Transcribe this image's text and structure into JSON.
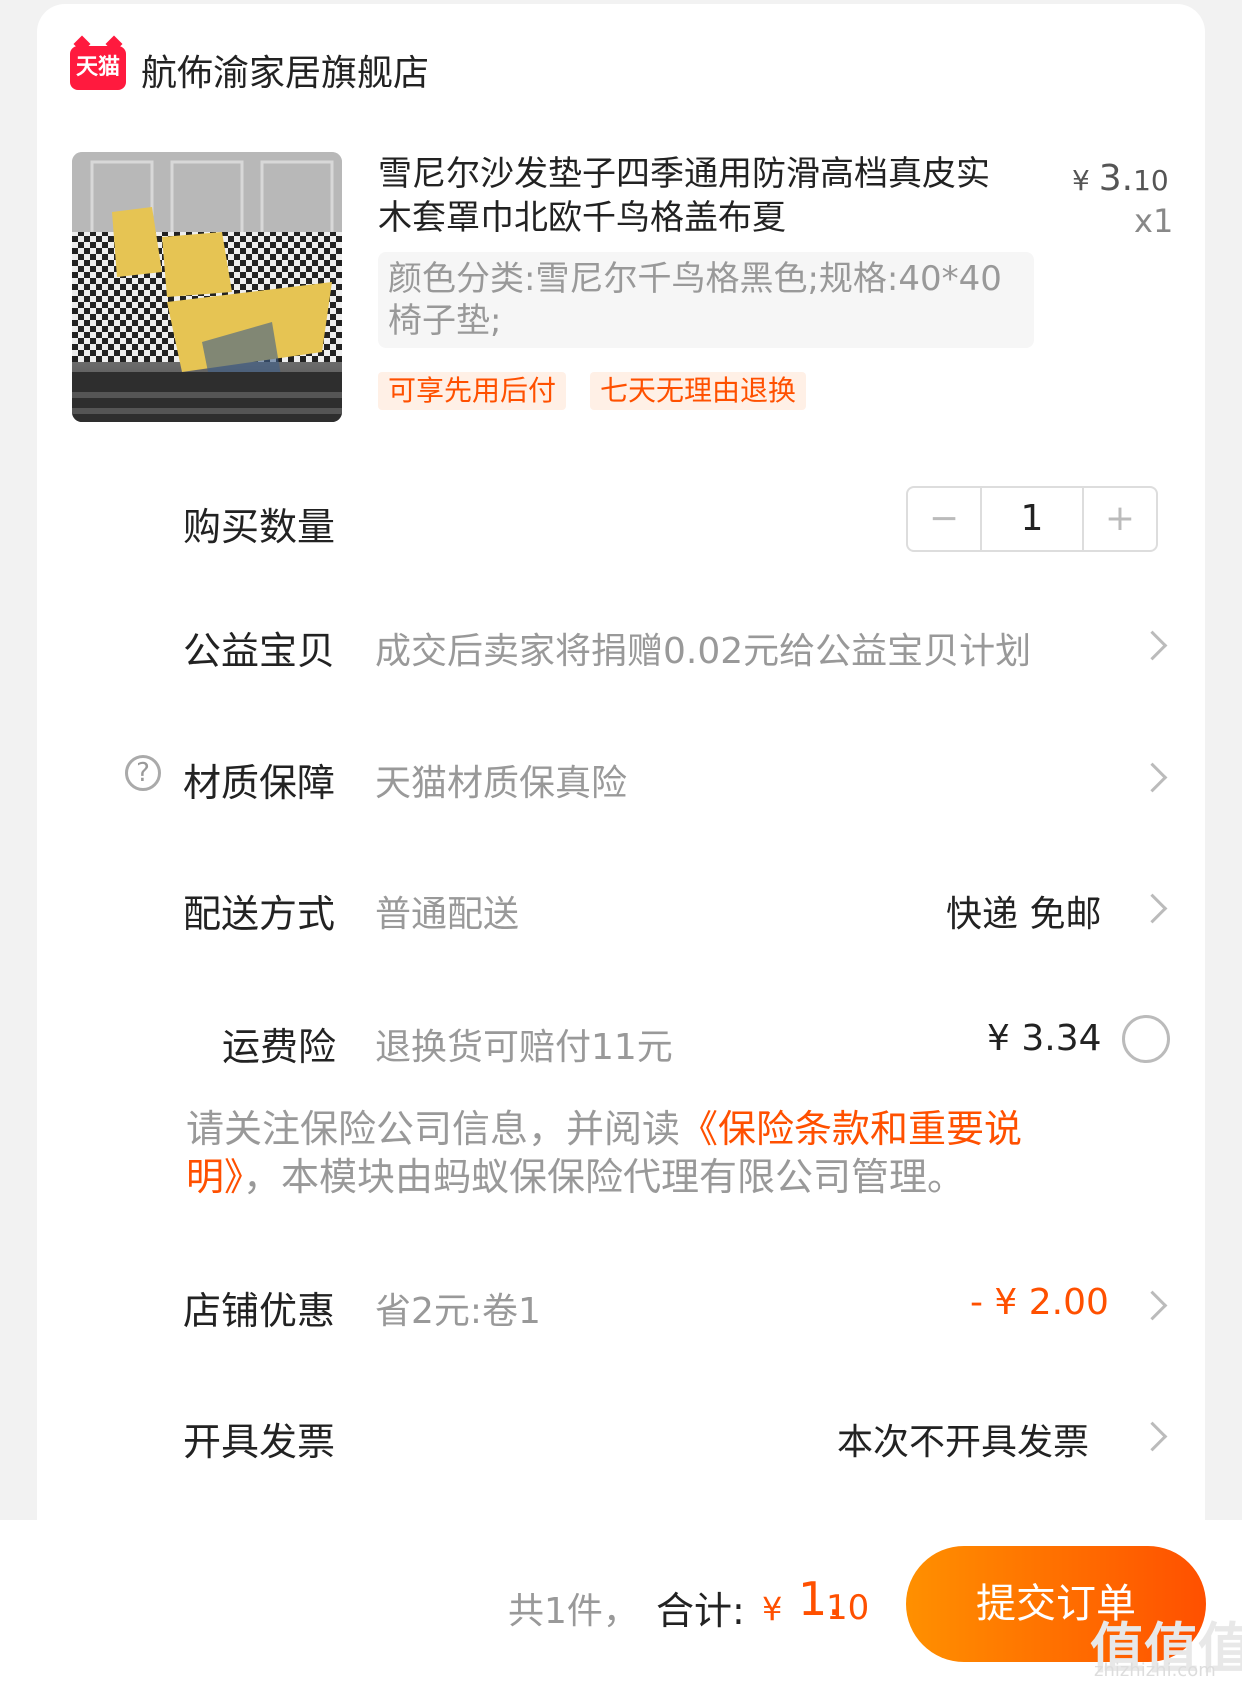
{
  "shop": {
    "logo_text": "天猫",
    "name": "航佈渝家居旗舰店"
  },
  "product": {
    "title": "雪尼尔沙发垫子四季通用防滑高档真皮实木套罩巾北欧千鸟格盖布夏",
    "price_symbol": "¥",
    "price_int": "3.",
    "price_dec": "10",
    "quantity_text": "x1",
    "sku": "颜色分类:雪尼尔千鸟格黑色;规格:40*40 椅子垫;",
    "tags": [
      "可享先用后付",
      "七天无理由退换"
    ]
  },
  "rows": {
    "quantity": {
      "label": "购买数量",
      "minus": "−",
      "value": "1",
      "plus": "+"
    },
    "charity": {
      "label": "公益宝贝",
      "value": "成交后卖家将捐赠0.02元给公益宝贝计划"
    },
    "material": {
      "label": "材质保障",
      "help": "?",
      "value": "天猫材质保真险"
    },
    "delivery": {
      "label": "配送方式",
      "value": "普通配送",
      "right": "快递 免邮"
    },
    "freight_insurance": {
      "label": "运费险",
      "value": "退换货可赔付11元",
      "right": "¥ 3.34"
    },
    "notice": {
      "before": "请关注保险公司信息，并阅读",
      "link": "《保险条款和重要说明》",
      "after": "，本模块由蚂蚁保保险代理有限公司管理。"
    },
    "shop_discount": {
      "label": "店铺优惠",
      "value": "省2元:卷1",
      "right": "- ¥ 2.00"
    },
    "invoice": {
      "label": "开具发票",
      "right": "本次不开具发票"
    }
  },
  "footer": {
    "count": "共1件，",
    "total_label": "合计:",
    "total_yen": "¥",
    "total_int": "1.",
    "total_dec": "10",
    "submit": "提交订单"
  },
  "watermark": {
    "main": "值值值",
    "sub": "zhizhizhi.com"
  },
  "colors": {
    "accent": "#ff5000",
    "gradient_start": "#ff9000",
    "tmall_red": "#ff1a3e"
  }
}
